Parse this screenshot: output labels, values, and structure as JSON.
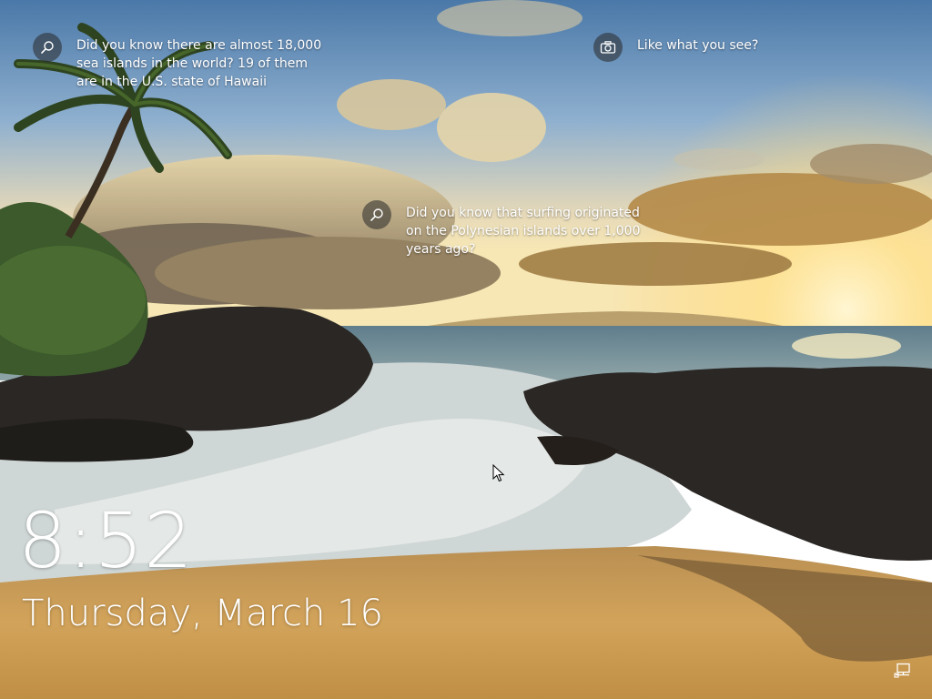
{
  "spotlight": {
    "hotspots": [
      {
        "icon": "search-icon",
        "text": "Did you know there are almost 18,000 sea islands in the world? 19 of them are in the U.S. state of Hawaii"
      },
      {
        "icon": "camera-icon",
        "text": "Like what you see?"
      },
      {
        "icon": "search-icon",
        "text": "Did you know that surfing originated on the Polynesian islands over 1,000 years ago?"
      }
    ]
  },
  "clock": {
    "time": "8:52",
    "date": "Thursday, March 16"
  },
  "status_tray": {
    "network_icon": "network-wired-icon"
  },
  "colors": {
    "text": "#ffffff",
    "hotspot_circle": "rgba(40,40,40,0.55)",
    "sky_top": "#4f7fb0",
    "sun": "#ffe6a3",
    "sand": "#c99a4c"
  }
}
